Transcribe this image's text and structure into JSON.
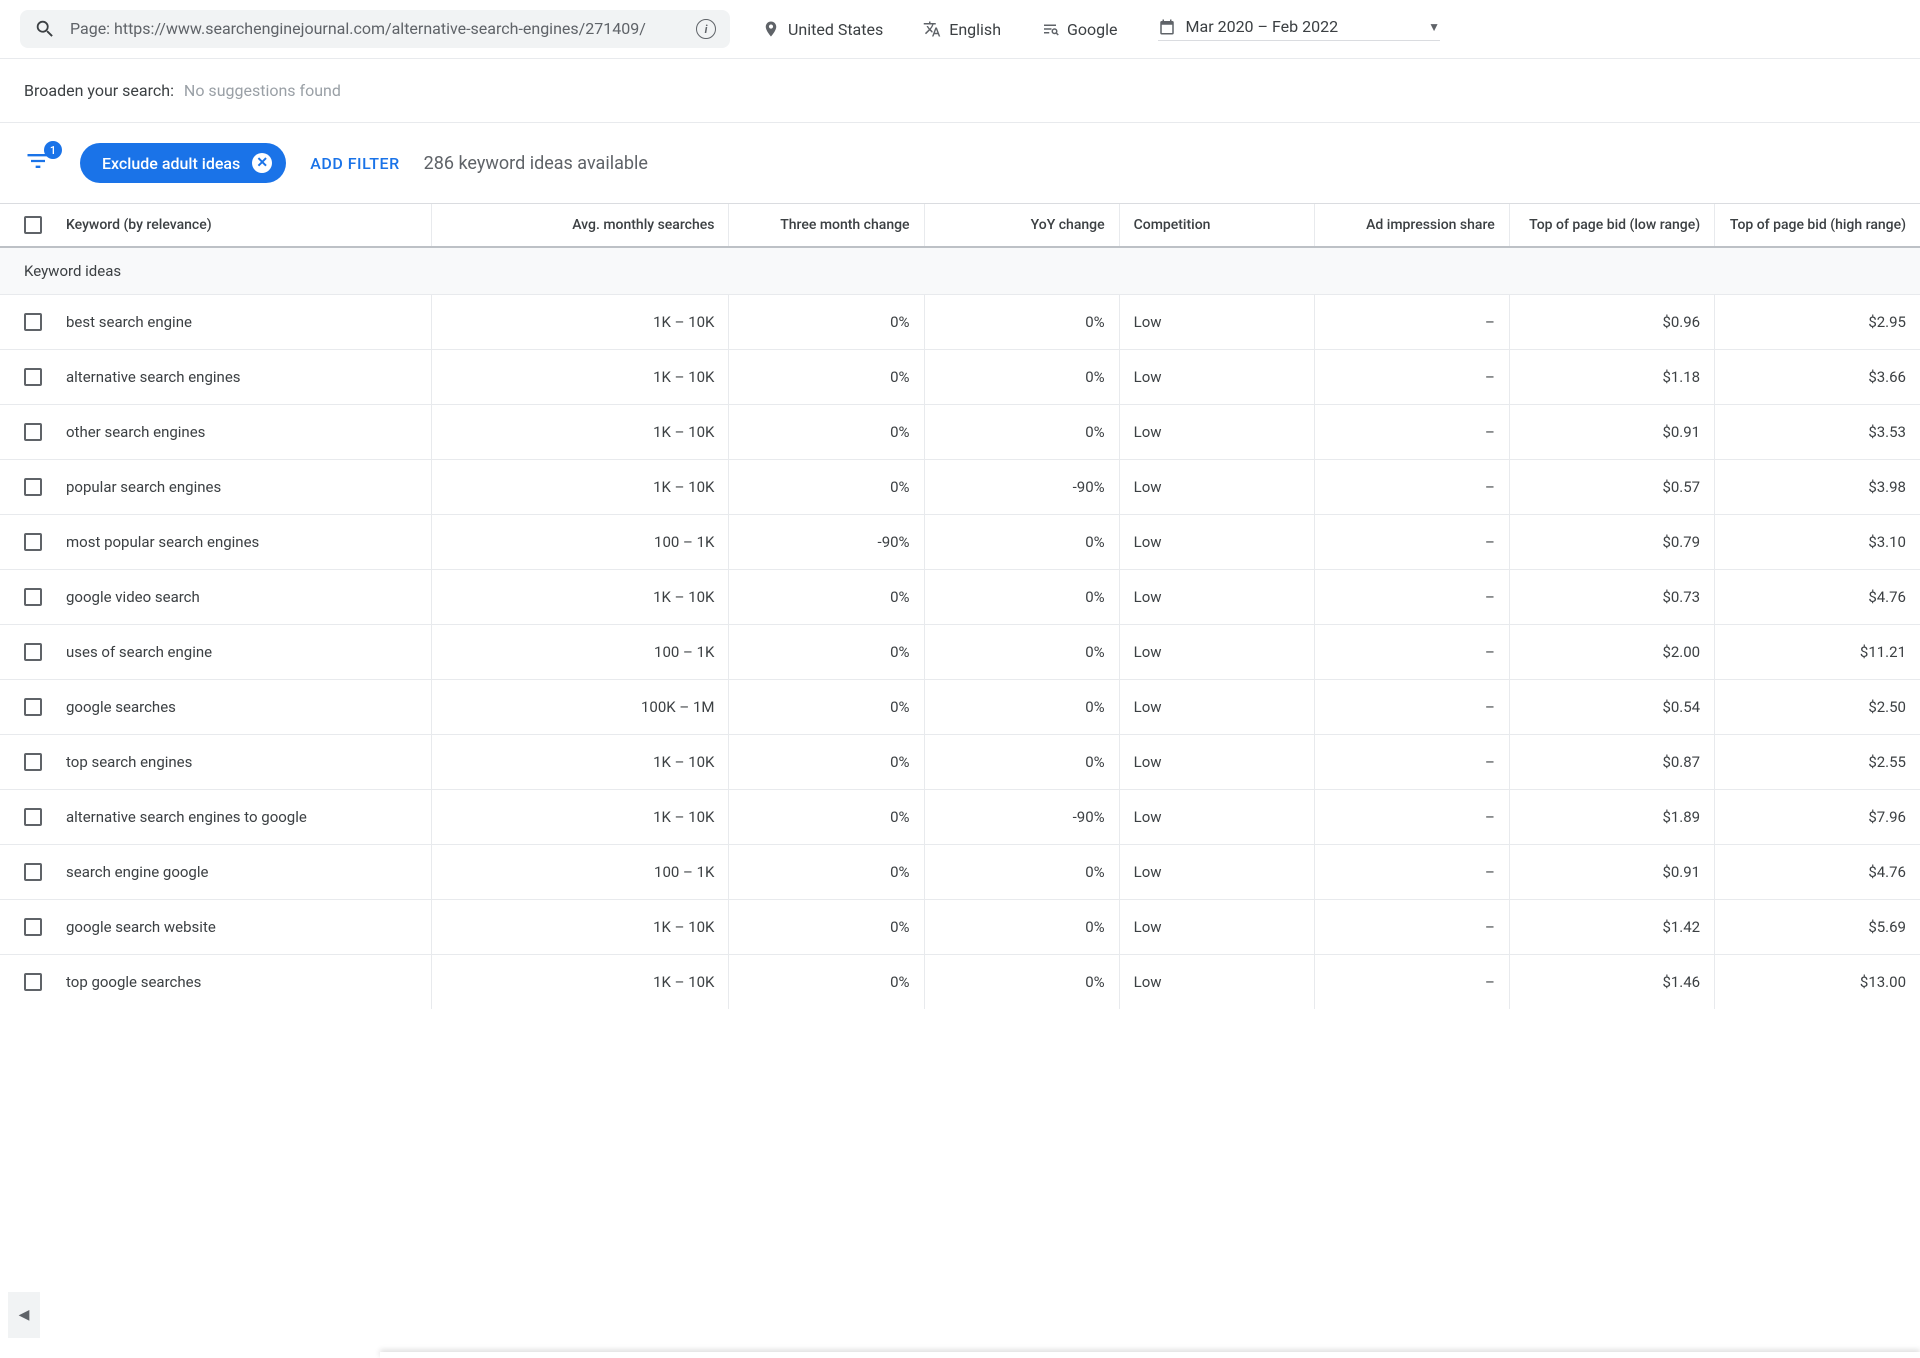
{
  "searchBar": {
    "pageLabel": "Page: https://www.searchenginejournal.com/alternative-search-engines/271409/"
  },
  "topFilters": {
    "location": "United States",
    "language": "English",
    "network": "Google",
    "dateRange": "Mar 2020 – Feb 2022"
  },
  "broaden": {
    "label": "Broaden your search:",
    "suggestion": "No suggestions found"
  },
  "filterRow": {
    "funnelBadge": "1",
    "chipLabel": "Exclude adult ideas",
    "addFilter": "ADD FILTER",
    "ideasAvailable": "286 keyword ideas available"
  },
  "columns": {
    "keyword": "Keyword (by relevance)",
    "avgSearches": "Avg. monthly searches",
    "threeMonth": "Three month change",
    "yoy": "YoY change",
    "competition": "Competition",
    "adImpression": "Ad impression share",
    "bidLow": "Top of page bid (low range)",
    "bidHigh": "Top of page bid (high range)"
  },
  "sectionLabel": "Keyword ideas",
  "rows": [
    {
      "keyword": "best search engine",
      "avg": "1K – 10K",
      "threeMonth": "0%",
      "yoy": "0%",
      "comp": "Low",
      "adimp": "–",
      "low": "$0.96",
      "high": "$2.95"
    },
    {
      "keyword": "alternative search engines",
      "avg": "1K – 10K",
      "threeMonth": "0%",
      "yoy": "0%",
      "comp": "Low",
      "adimp": "–",
      "low": "$1.18",
      "high": "$3.66"
    },
    {
      "keyword": "other search engines",
      "avg": "1K – 10K",
      "threeMonth": "0%",
      "yoy": "0%",
      "comp": "Low",
      "adimp": "–",
      "low": "$0.91",
      "high": "$3.53"
    },
    {
      "keyword": "popular search engines",
      "avg": "1K – 10K",
      "threeMonth": "0%",
      "yoy": "-90%",
      "comp": "Low",
      "adimp": "–",
      "low": "$0.57",
      "high": "$3.98"
    },
    {
      "keyword": "most popular search engines",
      "avg": "100 – 1K",
      "threeMonth": "-90%",
      "yoy": "0%",
      "comp": "Low",
      "adimp": "–",
      "low": "$0.79",
      "high": "$3.10"
    },
    {
      "keyword": "google video search",
      "avg": "1K – 10K",
      "threeMonth": "0%",
      "yoy": "0%",
      "comp": "Low",
      "adimp": "–",
      "low": "$0.73",
      "high": "$4.76"
    },
    {
      "keyword": "uses of search engine",
      "avg": "100 – 1K",
      "threeMonth": "0%",
      "yoy": "0%",
      "comp": "Low",
      "adimp": "–",
      "low": "$2.00",
      "high": "$11.21"
    },
    {
      "keyword": "google searches",
      "avg": "100K – 1M",
      "threeMonth": "0%",
      "yoy": "0%",
      "comp": "Low",
      "adimp": "–",
      "low": "$0.54",
      "high": "$2.50"
    },
    {
      "keyword": "top search engines",
      "avg": "1K – 10K",
      "threeMonth": "0%",
      "yoy": "0%",
      "comp": "Low",
      "adimp": "–",
      "low": "$0.87",
      "high": "$2.55"
    },
    {
      "keyword": "alternative search engines to google",
      "avg": "1K – 10K",
      "threeMonth": "0%",
      "yoy": "-90%",
      "comp": "Low",
      "adimp": "–",
      "low": "$1.89",
      "high": "$7.96"
    },
    {
      "keyword": "search engine google",
      "avg": "100 – 1K",
      "threeMonth": "0%",
      "yoy": "0%",
      "comp": "Low",
      "adimp": "–",
      "low": "$0.91",
      "high": "$4.76"
    },
    {
      "keyword": "google search website",
      "avg": "1K – 10K",
      "threeMonth": "0%",
      "yoy": "0%",
      "comp": "Low",
      "adimp": "–",
      "low": "$1.42",
      "high": "$5.69"
    },
    {
      "keyword": "top google searches",
      "avg": "1K – 10K",
      "threeMonth": "0%",
      "yoy": "0%",
      "comp": "Low",
      "adimp": "–",
      "low": "$1.46",
      "high": "$13.00"
    }
  ]
}
